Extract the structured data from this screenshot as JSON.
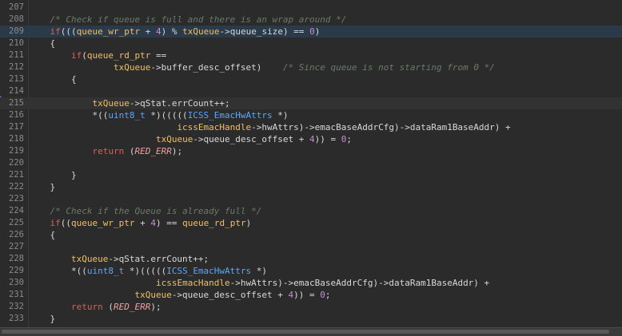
{
  "editor": {
    "lines": [
      {
        "n": "207",
        "t": ""
      },
      {
        "n": "208",
        "t": "    /* Check if queue is full and there is an wrap around */"
      },
      {
        "n": "209",
        "t": "    if(((queue_wr_ptr + 4) % txQueue->queue_size) == 0)"
      },
      {
        "n": "210",
        "t": "    {"
      },
      {
        "n": "211",
        "t": "        if(queue_rd_ptr =="
      },
      {
        "n": "212",
        "t": "                txQueue->buffer_desc_offset)    /* Since queue is not starting from 0 */"
      },
      {
        "n": "213",
        "t": "        {"
      },
      {
        "n": "214",
        "t": ""
      },
      {
        "n": "215",
        "t": "            txQueue->qStat.errCount++;"
      },
      {
        "n": "216",
        "t": "            *((uint8_t *)(((((ICSS_EmacHwAttrs *)"
      },
      {
        "n": "217",
        "t": "                            icssEmacHandle->hwAttrs)->emacBaseAddrCfg)->dataRam1BaseAddr) +"
      },
      {
        "n": "218",
        "t": "                        txQueue->queue_desc_offset + 4)) = 0;"
      },
      {
        "n": "219",
        "t": "            return (RED_ERR);"
      },
      {
        "n": "220",
        "t": ""
      },
      {
        "n": "221",
        "t": "        }"
      },
      {
        "n": "222",
        "t": "    }"
      },
      {
        "n": "223",
        "t": ""
      },
      {
        "n": "224",
        "t": "    /* Check if the Queue is already full */"
      },
      {
        "n": "225",
        "t": "    if((queue_wr_ptr + 4) == queue_rd_ptr)"
      },
      {
        "n": "226",
        "t": "    {"
      },
      {
        "n": "227",
        "t": ""
      },
      {
        "n": "228",
        "t": "        txQueue->qStat.errCount++;"
      },
      {
        "n": "229",
        "t": "        *((uint8_t *)(((((ICSS_EmacHwAttrs *)"
      },
      {
        "n": "230",
        "t": "                        icssEmacHandle->hwAttrs)->emacBaseAddrCfg)->dataRam1BaseAddr) +"
      },
      {
        "n": "231",
        "t": "                    txQueue->queue_desc_offset + 4)) = 0;"
      },
      {
        "n": "232",
        "t": "        return (RED_ERR);"
      },
      {
        "n": "233",
        "t": "    }"
      }
    ],
    "current_line": "209",
    "highlighted_line": "215",
    "colors": {
      "background": "#2b2b2b",
      "comment": "#6a7a6a",
      "keyword": "#e25c5c",
      "number": "#c78ad8",
      "type": "#59a6ff",
      "variable": "#f0c060",
      "macro": "#f0a0a0",
      "plain": "#d8d8d8"
    }
  }
}
